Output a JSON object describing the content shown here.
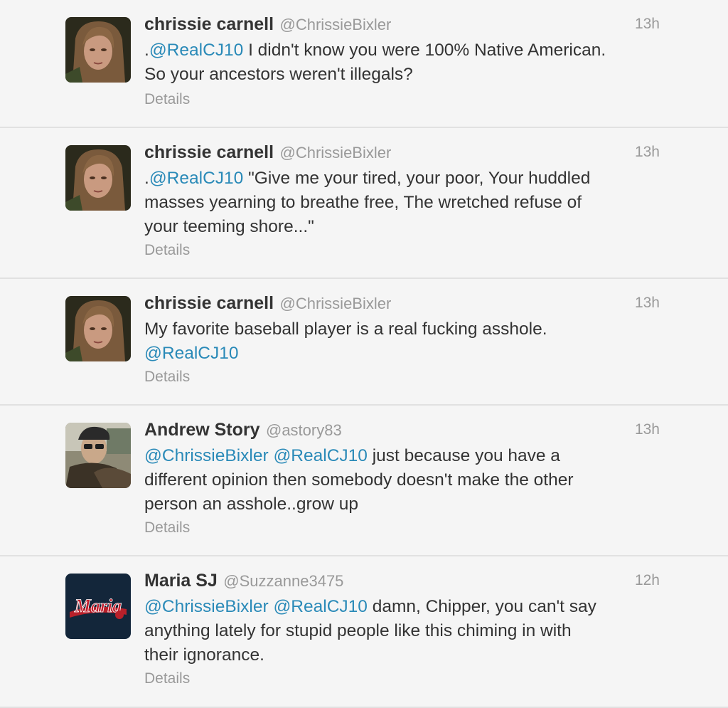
{
  "tweets": [
    {
      "name": "chrissie carnell",
      "handle": "@ChrissieBixler",
      "time": "13h",
      "avatar": "woman-avatar",
      "lines": [
        [
          {
            "t": ".",
            "m": false
          },
          {
            "t": "@RealCJ10",
            "m": true
          },
          {
            "t": " I didn't know you were 100% Native American.",
            "m": false
          }
        ],
        [
          {
            "t": "So your ancestors weren't illegals?",
            "m": false
          }
        ]
      ],
      "details": "Details"
    },
    {
      "name": "chrissie carnell",
      "handle": "@ChrissieBixler",
      "time": "13h",
      "avatar": "woman-avatar",
      "lines": [
        [
          {
            "t": ".",
            "m": false
          },
          {
            "t": "@RealCJ10",
            "m": true
          },
          {
            "t": " \"Give me your tired, your poor, Your huddled",
            "m": false
          }
        ],
        [
          {
            "t": "masses yearning to breathe free, The wretched refuse of",
            "m": false
          }
        ],
        [
          {
            "t": "your teeming shore...\"",
            "m": false
          }
        ]
      ],
      "details": "Details"
    },
    {
      "name": "chrissie carnell",
      "handle": "@ChrissieBixler",
      "time": "13h",
      "avatar": "woman-avatar",
      "lines": [
        [
          {
            "t": "My favorite baseball player is a real fucking asshole.",
            "m": false
          }
        ],
        [
          {
            "t": "@RealCJ10",
            "m": true
          }
        ]
      ],
      "details": "Details"
    },
    {
      "name": "Andrew Story",
      "handle": "@astory83",
      "time": "13h",
      "avatar": "man-in-car-avatar",
      "lines": [
        [
          {
            "t": "@ChrissieBixler",
            "m": true
          },
          {
            "t": " ",
            "m": false
          },
          {
            "t": "@RealCJ10",
            "m": true
          },
          {
            "t": " just because you have a",
            "m": false
          }
        ],
        [
          {
            "t": "different opinion then somebody doesn't make the other",
            "m": false
          }
        ],
        [
          {
            "t": "person an asshole..grow up",
            "m": false
          }
        ]
      ],
      "details": "Details"
    },
    {
      "name": "Maria SJ",
      "handle": "@Suzzanne3475",
      "time": "12h",
      "avatar": "maria-logo-avatar",
      "avatar_text": "Maria",
      "lines": [
        [
          {
            "t": "@ChrissieBixler",
            "m": true
          },
          {
            "t": " ",
            "m": false
          },
          {
            "t": "@RealCJ10",
            "m": true
          },
          {
            "t": " damn, Chipper, you can't say",
            "m": false
          }
        ],
        [
          {
            "t": "anything lately for stupid people like this chiming in with",
            "m": false
          }
        ],
        [
          {
            "t": "their ignorance.",
            "m": false
          }
        ]
      ],
      "details": "Details"
    }
  ],
  "colors": {
    "mention": "#2a8ab8",
    "muted": "#999999",
    "text": "#333333",
    "background": "#f5f5f5",
    "divider": "#e1e1e1"
  }
}
